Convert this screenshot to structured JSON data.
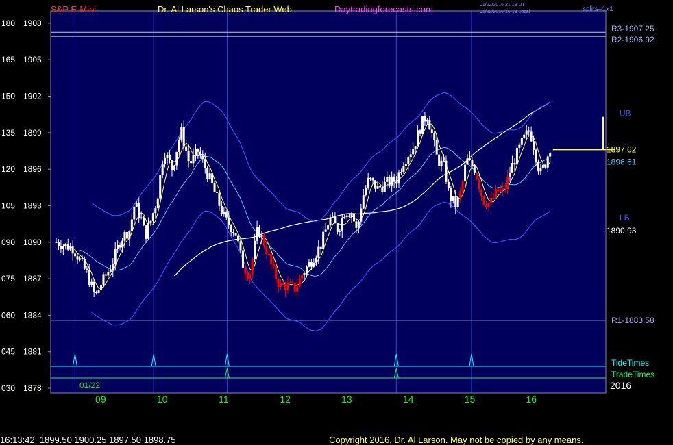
{
  "header": {
    "symbol": "S&P E-Mini",
    "title": "Dr. Al Larson's Chaos Trader Web",
    "site": "Daytradingforecasts.com",
    "stamp1": "01/22/2016 21:19 UT",
    "stamp2": "01/22/2016 16:13 Local",
    "setting": "splits=1x1"
  },
  "footer": {
    "quote": "16:13:42  1899.50 1900.25 1897.50 1898.75",
    "copyright": "Copyright 2016, Dr. Al Larson. May not be copied by any means."
  },
  "colors": {
    "plot_bg": "#00005c",
    "up_candle": "#ffffff",
    "down_candle": "#ff0000",
    "fast_ma": "#ffff44",
    "mid_ma": "#44ccff",
    "band": "#3355ff",
    "slow_ma": "#ffffff",
    "tide": "#00ffff",
    "trade": "#00ff66",
    "date_label": "#00ff00"
  },
  "chart_data": {
    "type": "candlestick",
    "y_range": [
      1878,
      1908.5
    ],
    "left_axis_ticks": [
      {
        "osc": "180",
        "price": 1908
      },
      {
        "osc": "165",
        "price": 1905
      },
      {
        "osc": "150",
        "price": 1902
      },
      {
        "osc": "135",
        "price": 1899
      },
      {
        "osc": "120",
        "price": 1896
      },
      {
        "osc": "105",
        "price": 1893
      },
      {
        "osc": "090",
        "price": 1890
      },
      {
        "osc": "075",
        "price": 1887
      },
      {
        "osc": "060",
        "price": 1884
      },
      {
        "osc": "045",
        "price": 1881
      },
      {
        "osc": "030",
        "price": 1878
      }
    ],
    "x_labels": [
      {
        "t": 1.3,
        "label": "09"
      },
      {
        "t": 3.1,
        "label": "10"
      },
      {
        "t": 4.9,
        "label": "11"
      },
      {
        "t": 6.7,
        "label": "12"
      },
      {
        "t": 8.5,
        "label": "13"
      },
      {
        "t": 10.3,
        "label": "14"
      },
      {
        "t": 12.1,
        "label": "15"
      },
      {
        "t": 13.9,
        "label": "16"
      }
    ],
    "date_label": "01/22",
    "year_label": "2016",
    "vlines": [
      0.55,
      2.85,
      5.0,
      9.95,
      12.15
    ],
    "levels": [
      {
        "label": "R3-1907.25",
        "price": 1907.25
      },
      {
        "label": "R2-1906.92",
        "price": 1906.92
      },
      {
        "label": "R1-1883.58",
        "price": 1883.58
      }
    ],
    "price_labels": [
      {
        "label": "1897.62",
        "price": 1897.62,
        "color": "#ffff44"
      },
      {
        "label": "1896.61",
        "price": 1896.61,
        "color": "#44ccff"
      },
      {
        "label": "1890.93",
        "price": 1890.93,
        "color": "#ffffff"
      }
    ],
    "band_labels": [
      {
        "label": "UB",
        "price": 1900.6
      },
      {
        "label": "LB",
        "price": 1892.0
      }
    ],
    "tide_times": {
      "label": "TideTimes",
      "times": [
        0.55,
        2.85,
        5.0,
        9.95,
        12.15
      ]
    },
    "trade_times": {
      "label": "TradeTimes",
      "times": [
        5.0,
        9.95
      ]
    },
    "anchors": [
      [
        0.0,
        1890.0
      ],
      [
        0.5,
        1889.5
      ],
      [
        0.9,
        1887.4
      ],
      [
        1.15,
        1885.5
      ],
      [
        1.3,
        1886.5
      ],
      [
        1.6,
        1888.0
      ],
      [
        1.9,
        1890.3
      ],
      [
        2.15,
        1891.0
      ],
      [
        2.3,
        1893.2
      ],
      [
        2.5,
        1891.8
      ],
      [
        2.6,
        1890.5
      ],
      [
        2.75,
        1891.6
      ],
      [
        2.95,
        1893.5
      ],
      [
        3.15,
        1897.6
      ],
      [
        3.4,
        1896.0
      ],
      [
        3.65,
        1899.2
      ],
      [
        3.9,
        1896.4
      ],
      [
        4.15,
        1897.5
      ],
      [
        4.45,
        1895.5
      ],
      [
        4.7,
        1893.6
      ],
      [
        4.95,
        1891.8
      ],
      [
        5.25,
        1890.8
      ],
      [
        5.45,
        1888.2
      ],
      [
        5.65,
        1887.2
      ],
      [
        5.9,
        1891.2
      ],
      [
        6.15,
        1889.4
      ],
      [
        6.35,
        1887.6
      ],
      [
        6.55,
        1886.4
      ],
      [
        6.8,
        1886.4
      ],
      [
        7.0,
        1886.2
      ],
      [
        7.2,
        1887.4
      ],
      [
        7.45,
        1888.4
      ],
      [
        7.75,
        1889.8
      ],
      [
        8.0,
        1892.0
      ],
      [
        8.25,
        1891.0
      ],
      [
        8.45,
        1892.6
      ],
      [
        8.65,
        1892.4
      ],
      [
        8.8,
        1890.8
      ],
      [
        8.95,
        1893.6
      ],
      [
        9.15,
        1895.2
      ],
      [
        9.4,
        1894.4
      ],
      [
        9.7,
        1894.9
      ],
      [
        9.95,
        1895.1
      ],
      [
        10.15,
        1896.6
      ],
      [
        10.45,
        1897.8
      ],
      [
        10.7,
        1899.8
      ],
      [
        10.85,
        1900.5
      ],
      [
        11.0,
        1898.8
      ],
      [
        11.15,
        1896.8
      ],
      [
        11.35,
        1896.2
      ],
      [
        11.5,
        1893.8
      ],
      [
        11.7,
        1893.0
      ],
      [
        11.85,
        1894.2
      ],
      [
        12.0,
        1896.8
      ],
      [
        12.25,
        1896.0
      ],
      [
        12.5,
        1893.4
      ],
      [
        12.7,
        1893.2
      ],
      [
        12.9,
        1894.2
      ],
      [
        13.1,
        1894.2
      ],
      [
        13.3,
        1896.0
      ],
      [
        13.5,
        1897.4
      ],
      [
        13.7,
        1898.6
      ],
      [
        13.85,
        1899.2
      ],
      [
        14.0,
        1897.6
      ],
      [
        14.15,
        1895.6
      ],
      [
        14.3,
        1896.4
      ],
      [
        14.45,
        1897.8
      ]
    ],
    "forecast_end": 16.0
  }
}
